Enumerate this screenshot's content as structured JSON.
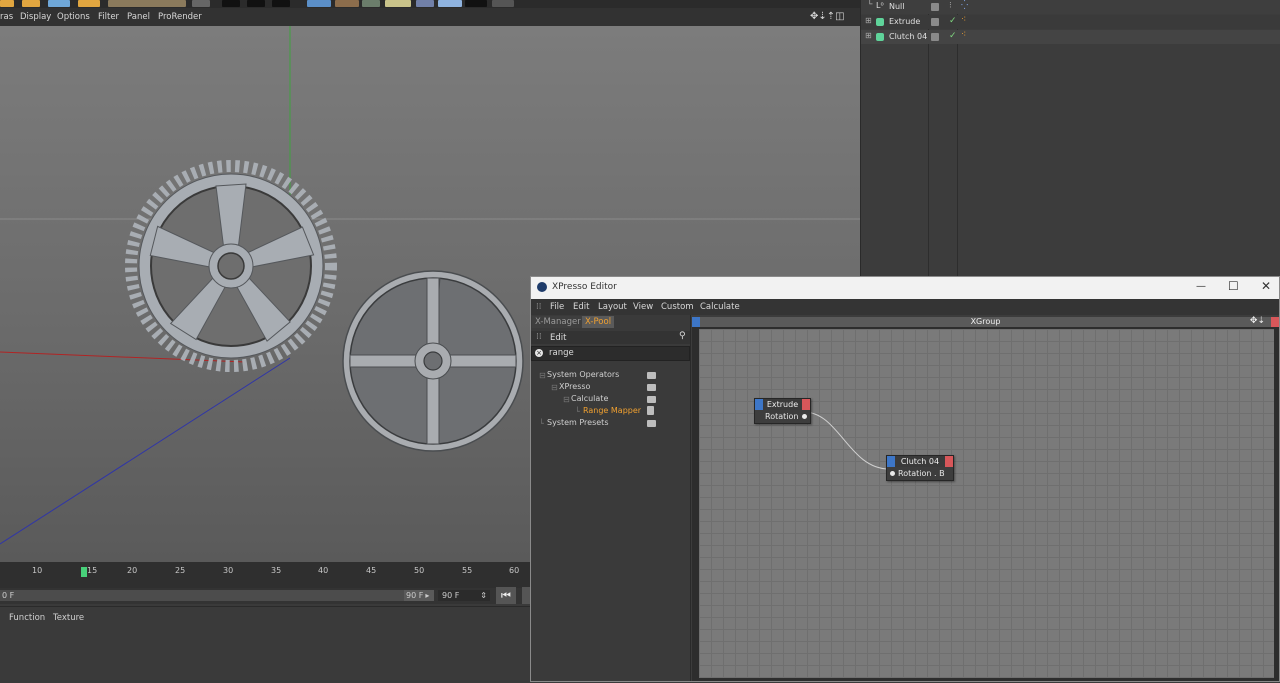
{
  "viewport": {
    "menu": [
      "ras",
      "Display",
      "Options",
      "Filter",
      "Panel",
      "ProRender"
    ]
  },
  "timeline": {
    "ticks": [
      "10",
      "15",
      "20",
      "25",
      "30",
      "35",
      "40",
      "45",
      "50",
      "55",
      "60"
    ],
    "frame_start": "0 F",
    "frame_end_bar": "90 F",
    "frame_end_field": "90 F"
  },
  "bottom_panel": {
    "tabs": [
      "Function",
      "Texture"
    ]
  },
  "object_manager": {
    "items": [
      {
        "name": "Null",
        "icon_color": "#d0d0d0"
      },
      {
        "name": "Extrude",
        "icon_color": "#5fd39a"
      },
      {
        "name": "Clutch 04",
        "icon_color": "#5fd39a"
      }
    ]
  },
  "xpresso": {
    "window_title": "XPresso Editor",
    "minimize_glyph": "—",
    "maximize_glyph": "☐",
    "close_glyph": "✕",
    "menu": [
      "File",
      "Edit",
      "Layout",
      "View",
      "Custom",
      "Calculate"
    ],
    "tabs": {
      "xmanager": "X-Manager",
      "xpool": "X-Pool"
    },
    "edit_label": "Edit",
    "search_value": "range",
    "tree": [
      {
        "label": "System Operators",
        "highlight": false
      },
      {
        "label": "XPresso",
        "highlight": false
      },
      {
        "label": "Calculate",
        "highlight": false
      },
      {
        "label": "Range Mapper",
        "highlight": true
      },
      {
        "label": "System Presets",
        "highlight": false
      }
    ],
    "group_title": "XGroup",
    "nodes": {
      "extrude": {
        "title": "Extrude",
        "port": "Rotation"
      },
      "clutch": {
        "title": "Clutch 04",
        "port": "Rotation . B"
      }
    }
  },
  "colors": {
    "accent_orange": "#f0a030",
    "node_blue": "#3d76c7",
    "node_red": "#d8575a",
    "playhead_green": "#48d17a"
  }
}
